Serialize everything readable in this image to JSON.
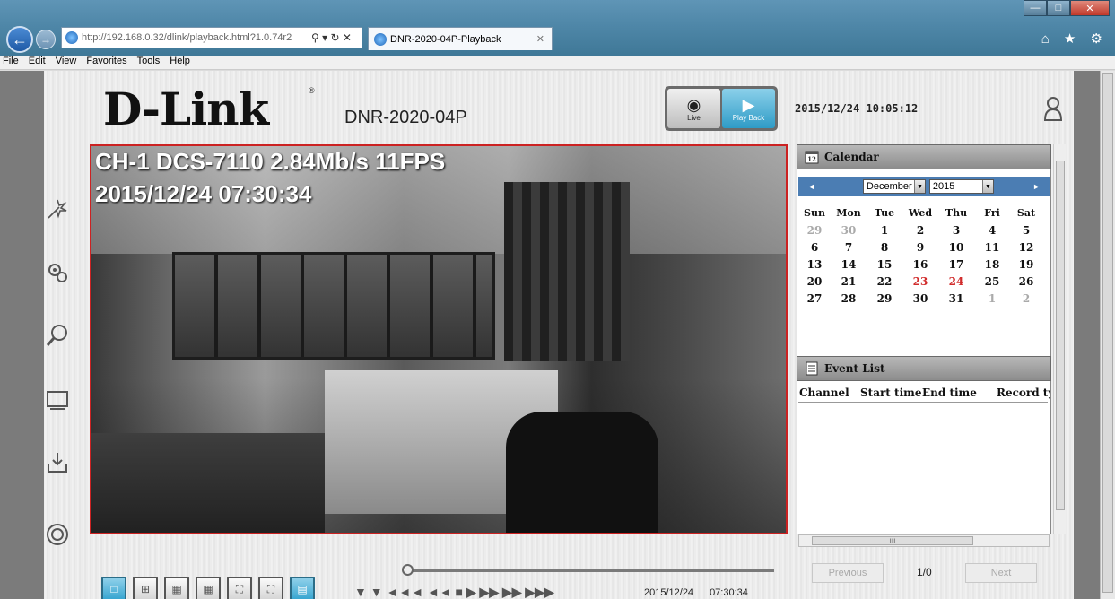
{
  "browser": {
    "url": "http://192.168.0.32/dlink/playback.html?1.0.74r2",
    "addr_tools": "⚲ ▾ ↻ ✕",
    "tab_title": "DNR-2020-04P-Playback",
    "tab_close": "✕",
    "right_tools": "⌂ ★ ⚙",
    "window_buttons": {
      "minimize": "—",
      "maximize": "□",
      "close": "✕"
    },
    "menu": [
      "File",
      "Edit",
      "View",
      "Favorites",
      "Tools",
      "Help"
    ]
  },
  "header": {
    "logo": "D-Link",
    "registered": "®",
    "model": "DNR-2020-04P",
    "live_label": "Live",
    "playback_label": "Play Back",
    "datetime": "2015/12/24 10:05:12"
  },
  "sidebar": {
    "items": [
      "wizard-icon",
      "settings-icon",
      "search-icon",
      "display-icon",
      "download-icon",
      "help-icon"
    ]
  },
  "video": {
    "osd_line1": "CH-1 DCS-7110 2.84Mb/s 11FPS",
    "osd_line2": "2015/12/24 07:30:34"
  },
  "calendar": {
    "title": "Calendar",
    "month": "December",
    "year": "2015",
    "prev": "◄",
    "next": "►",
    "weekdays": [
      "Sun",
      "Mon",
      "Tue",
      "Wed",
      "Thu",
      "Fri",
      "Sat"
    ],
    "weeks": [
      [
        "29",
        "30",
        "1",
        "2",
        "3",
        "4",
        "5"
      ],
      [
        "6",
        "7",
        "8",
        "9",
        "10",
        "11",
        "12"
      ],
      [
        "13",
        "14",
        "15",
        "16",
        "17",
        "18",
        "19"
      ],
      [
        "20",
        "21",
        "22",
        "23",
        "24",
        "25",
        "26"
      ],
      [
        "27",
        "28",
        "29",
        "30",
        "31",
        "1",
        "2"
      ]
    ],
    "highlighted_dates": [
      "23",
      "24"
    ],
    "highlight_color": "#d12b2b"
  },
  "event_list": {
    "title": "Event List",
    "columns": [
      "Channel",
      "Start time",
      "End time",
      "Record ty"
    ],
    "rows": [],
    "previous": "Previous",
    "next": "Next",
    "page_info": "1/0"
  },
  "playback": {
    "date": "2015/12/24",
    "time": "07:30:34",
    "controls": "▼ ▼ ◄◄◄ ◄◄ ■ ▶ ▶▶ ▶▶ ▶▶▶",
    "accent": "#2aa3d3"
  }
}
